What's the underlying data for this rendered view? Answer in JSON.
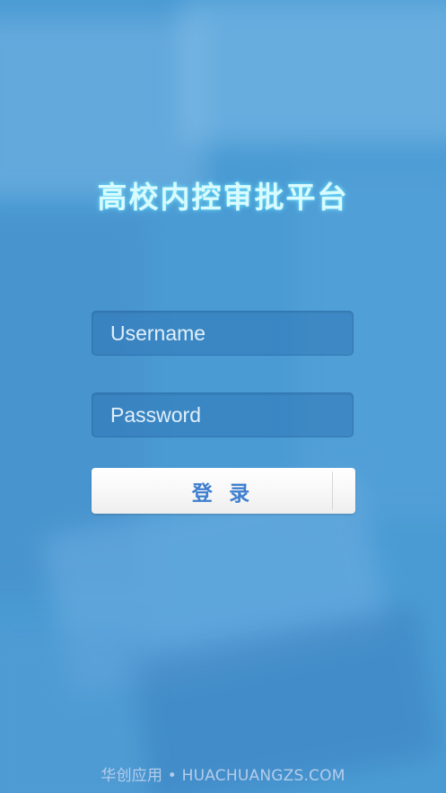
{
  "app": {
    "title": "高校内控审批平台"
  },
  "login": {
    "username_placeholder": "Username",
    "password_placeholder": "Password",
    "username_value": "",
    "password_value": "",
    "submit_label": "登 录"
  },
  "footer": {
    "watermark": "华创应用 • HUACHUANGZS.COM"
  },
  "colors": {
    "background": "#4a9bd4",
    "title": "#d9fbff",
    "button_text": "#3f7fcf"
  }
}
